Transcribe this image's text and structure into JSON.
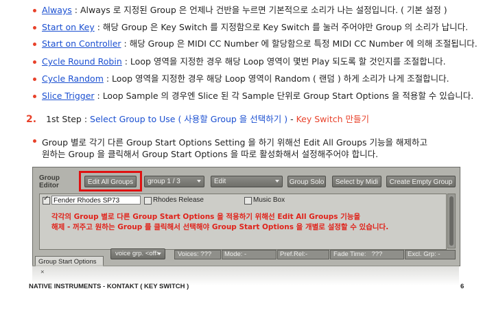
{
  "bullets": [
    {
      "term": "Always",
      "desc": " : Always 로 지정된 Group 은 언제나 건반을 누르면 기본적으로 소리가 나는 설정입니다. ( 기본 설정 )"
    },
    {
      "term": "Start on Key",
      "desc": " : 해당 Group 은 Key Switch 를 지정함으로 Key Switch 를 눌러 주어야만 Group 의 소리가 납니다."
    },
    {
      "term": "Start on Controller",
      "desc": " : 해당 Group 은 MIDI CC Number 에 할당함으로 특정 MIDI CC Number 에 의해 조절됩니다."
    },
    {
      "term": "Cycle Round Robin",
      "desc": " : Loop 영역을 지정한 경우 해당 Loop 영역이 몇번 Play 되도록 할 것인지를 조절합니다."
    },
    {
      "term": "Cycle Random",
      "desc": " : Loop 영역을 지정한 경우 해당 Loop 영역이 Random ( 랜덤 ) 하게 소리가 나게 조절합니다."
    },
    {
      "term": "Slice Trigger",
      "desc": " : Loop Sample 의 경우엔 Slice 된 각 Sample 단위로 Group Start Options 을 적용할 수 있습니다."
    }
  ],
  "step": {
    "number": "2.",
    "prefix": "1st Step : ",
    "blue": "Select Group to Use ( 사용할 Group 을 선택하기 )",
    "dash": " - ",
    "red": "Key Switch 만들기"
  },
  "paragraph": {
    "line1": "Group 별로 각기 다른 Group Start Options Setting 을 하기 위해선 Edit All Groups 기능을 해제하고",
    "line2": "원하는 Group 을 클릭해서 Group Start Options 을 따로 활성화해서 설정해주어야 합니다."
  },
  "panel": {
    "title_line1": "Group",
    "title_line2": "Editor",
    "edit_all_groups": "Edit All Groups",
    "group_select": "group 1 / 3",
    "edit_select": "Edit",
    "group_solo": "Group Solo",
    "select_by_midi": "Select by Midi",
    "create_empty_group": "Create Empty Group",
    "groups": [
      {
        "name": "Fender Rhodes SP73",
        "checked": true
      },
      {
        "name": "Rhodes Release",
        "checked": false
      },
      {
        "name": "Music Box",
        "checked": false
      }
    ],
    "note_line1": "각각의 Group 별로 다른 Group Start Options 을 적용하기 위해선 Edit All Groups 기능을",
    "note_line2": "해제 - 꺼주고 원하는 Group 를 클릭해서 선택해야 Group Start Options 을 개별로 설정할 수 있습니다.",
    "tab_label": "Group Start Options",
    "voice_grp": "voice grp. <off>",
    "voices_label": "Voices:",
    "voices_value": "???",
    "mode_label": "Mode: -",
    "pref_rel_label": "Pref.Rel:-",
    "fade_time_label": "Fade Time:",
    "fade_time_value": "???",
    "excl_grp_label": "Excl. Grp: -"
  },
  "footer": {
    "left": "NATIVE INSTRUMENTS - KONTAKT ( KEY SWITCH )",
    "page": "6"
  },
  "colors": {
    "link_blue": "#1a4fd1",
    "accent_red": "#e8412a",
    "highlight_box": "#e01010",
    "panel_gray": "#b3b3ad"
  }
}
